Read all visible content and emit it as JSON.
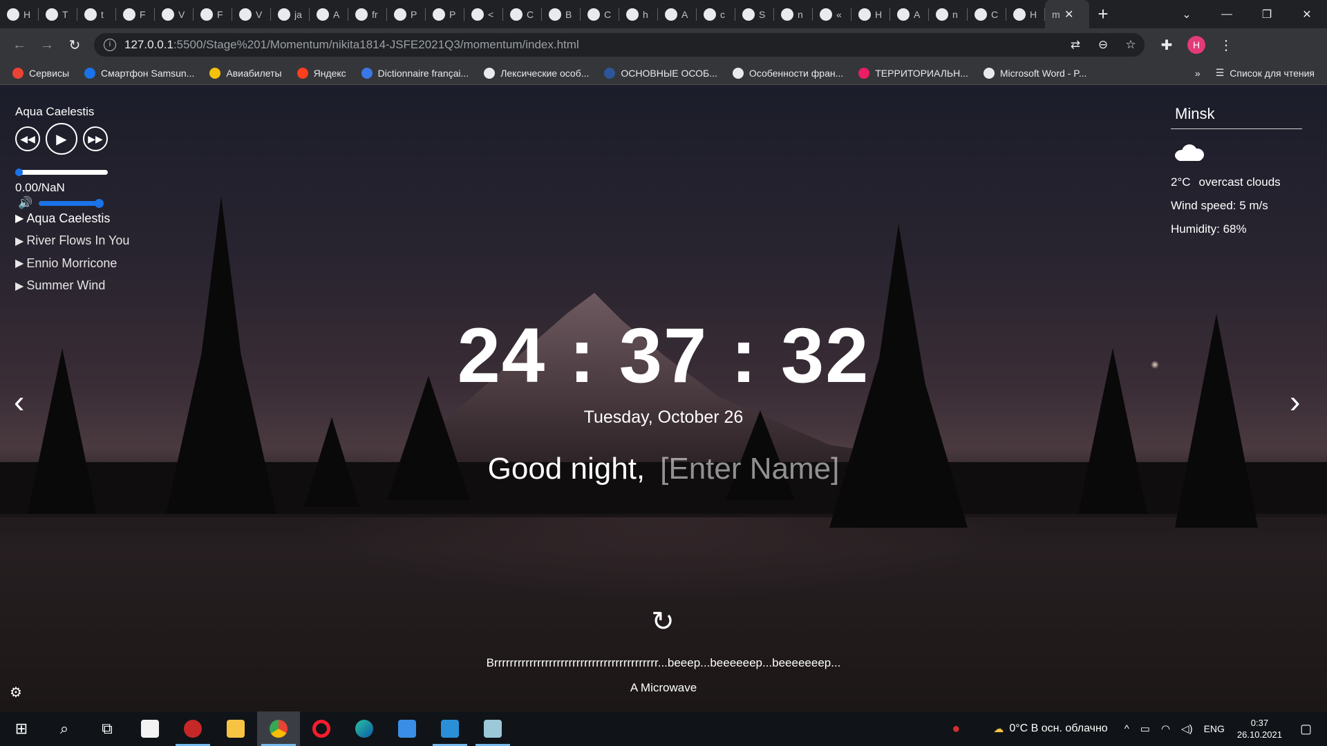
{
  "browser": {
    "tabs": [
      {
        "icon": "github-icon",
        "label": "Н"
      },
      {
        "icon": "globe-icon",
        "label": "Т"
      },
      {
        "icon": "github-icon",
        "label": "t"
      },
      {
        "icon": "globe-icon",
        "label": "F"
      },
      {
        "icon": "flag-icon",
        "label": "V"
      },
      {
        "icon": "w-icon",
        "label": "F"
      },
      {
        "icon": "flag-icon",
        "label": "V"
      },
      {
        "icon": "stack-icon",
        "label": "ja"
      },
      {
        "icon": "chat-icon",
        "label": "A"
      },
      {
        "icon": "google-icon",
        "label": "fr"
      },
      {
        "icon": "flag-icon",
        "label": "P"
      },
      {
        "icon": "flag-icon",
        "label": "P"
      },
      {
        "icon": "chat-icon",
        "label": "<"
      },
      {
        "icon": "gmail-icon",
        "label": "C"
      },
      {
        "icon": "page-icon",
        "label": "B"
      },
      {
        "icon": "page-icon",
        "label": "C"
      },
      {
        "icon": "globe-icon",
        "label": "h"
      },
      {
        "icon": "rs-icon",
        "label": "A"
      },
      {
        "icon": "grid-icon",
        "label": "c"
      },
      {
        "icon": "chat-icon",
        "label": "S"
      },
      {
        "icon": "m-icon",
        "label": "n"
      },
      {
        "icon": "box-icon",
        "label": "«"
      },
      {
        "icon": "chrome-icon",
        "label": "H"
      },
      {
        "icon": "rs-icon",
        "label": "A"
      },
      {
        "icon": "github-icon",
        "label": "n"
      },
      {
        "icon": "github-icon",
        "label": "C"
      },
      {
        "icon": "chrome-icon",
        "label": "H"
      }
    ],
    "active_tab_label": "m",
    "url_host": "127.0.0.1",
    "url_path": ":5500/Stage%201/Momentum/nikita1814-JSFE2021Q3/momentum/index.html",
    "bookmarks": [
      {
        "label": "Сервисы",
        "color": "#ea4335"
      },
      {
        "label": "Смартфон Samsun...",
        "color": "#1a73e8"
      },
      {
        "label": "Авиабилеты",
        "color": "#f4c20d"
      },
      {
        "label": "Яндекс",
        "color": "#fc3f1d"
      },
      {
        "label": "Dictionnaire françai...",
        "color": "#3b78e7"
      },
      {
        "label": "Лексические особ...",
        "color": "#e8eaed"
      },
      {
        "label": "ОСНОВНЫЕ ОСОБ...",
        "color": "#2b579a"
      },
      {
        "label": "Особенности фран...",
        "color": "#e8eaed"
      },
      {
        "label": "ТЕРРИТОРИАЛЬН...",
        "color": "#e91e63"
      },
      {
        "label": "Microsoft Word - P...",
        "color": "#e8eaed"
      }
    ],
    "bookmarks_more": "»",
    "reading_list": "Список для чтения",
    "avatar_letter": "H"
  },
  "player": {
    "current_title": "Aqua Caelestis",
    "time": "0.00/NaN",
    "progress": 0,
    "volume": 1,
    "playlist": [
      {
        "title": "Aqua Caelestis",
        "active": true
      },
      {
        "title": "River Flows In You",
        "active": false
      },
      {
        "title": "Ennio Morricone",
        "active": false
      },
      {
        "title": "Summer Wind",
        "active": false
      }
    ]
  },
  "weather": {
    "city": "Minsk",
    "temperature": "2°C",
    "description": "overcast clouds",
    "wind": "Wind speed: 5 m/s",
    "humidity": "Humidity: 68%"
  },
  "clock": {
    "hours": "24",
    "minutes": "37",
    "seconds": "32",
    "separator": ":"
  },
  "date": "Tuesday, October 26",
  "greeting": {
    "text": "Good night,",
    "name_placeholder": "[Enter Name]"
  },
  "quote": {
    "text": "Brrrrrrrrrrrrrrrrrrrrrrrrrrrrrrrrrrrrrrrrrr...beeep...beeeeeep...beeeeeeep...",
    "author": "A Microwave"
  },
  "taskbar": {
    "weather": "0°C  В осн. облачно",
    "lang": "ENG",
    "time": "0:37",
    "date": "26.10.2021"
  }
}
